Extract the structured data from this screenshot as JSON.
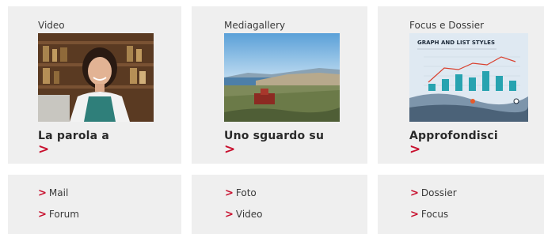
{
  "cards": [
    {
      "category": "Video",
      "title": "La parola a",
      "arrow": ">"
    },
    {
      "category": "Mediagallery",
      "title": "Uno sguardo su",
      "arrow": ">"
    },
    {
      "category": "Focus e Dossier",
      "title": "Approfondisci",
      "arrow": ">",
      "thumb_heading": "GRAPH AND LIST STYLES"
    }
  ],
  "links": [
    {
      "items": [
        {
          "chev": ">",
          "label": "Mail"
        },
        {
          "chev": ">",
          "label": "Forum"
        }
      ]
    },
    {
      "items": [
        {
          "chev": ">",
          "label": "Foto"
        },
        {
          "chev": ">",
          "label": "Video"
        }
      ]
    },
    {
      "items": [
        {
          "chev": ">",
          "label": "Dossier"
        },
        {
          "chev": ">",
          "label": "Focus"
        }
      ]
    }
  ],
  "colors": {
    "accent": "#c8102e",
    "panel": "#efefef",
    "text": "#2a2a2a"
  }
}
